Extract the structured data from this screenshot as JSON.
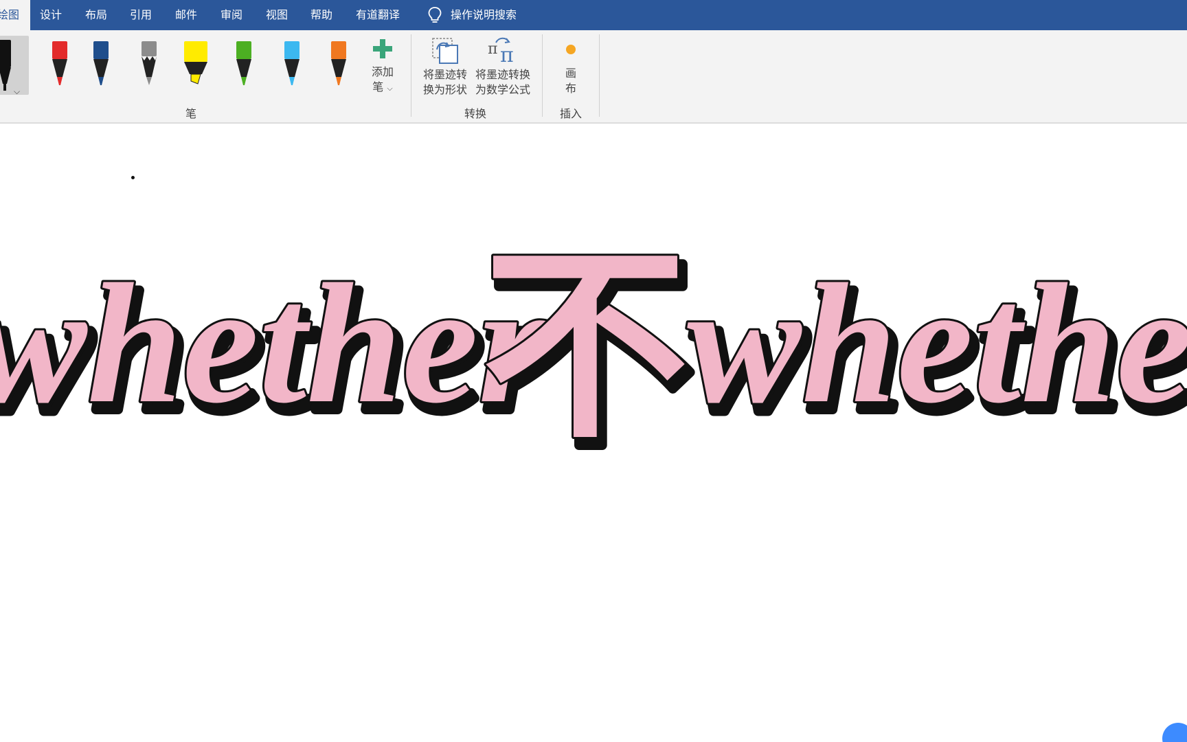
{
  "tabs": [
    {
      "label": "绘图",
      "active": true
    },
    {
      "label": "设计"
    },
    {
      "label": "布局"
    },
    {
      "label": "引用"
    },
    {
      "label": "邮件"
    },
    {
      "label": "审阅"
    },
    {
      "label": "视图"
    },
    {
      "label": "帮助"
    },
    {
      "label": "有道翻译"
    }
  ],
  "search": {
    "label": "操作说明搜索",
    "icon": "lightbulb-icon"
  },
  "ribbon": {
    "pens": [
      {
        "name": "black-pen",
        "color": "#111111",
        "selected": true
      },
      {
        "name": "red-pen",
        "color": "#e32b2b"
      },
      {
        "name": "navy-pen",
        "color": "#1f4e8c"
      },
      {
        "name": "gray-pencil",
        "color": "#8c8c8c"
      },
      {
        "name": "yellow-highlighter",
        "color": "#ffeb00"
      },
      {
        "name": "green-pen",
        "color": "#4caf22"
      },
      {
        "name": "cyan-pen",
        "color": "#3cb8f0"
      },
      {
        "name": "orange-pen",
        "color": "#f07820"
      }
    ],
    "add_pen": {
      "line1": "添加",
      "line2": "笔",
      "icon": "plus-icon",
      "icon_color": "#3aa57a"
    },
    "pen_group_label": "笔",
    "convert_shape": {
      "line1": "将墨迹转",
      "line2": "换为形状"
    },
    "convert_math": {
      "line1": "将墨迹转换",
      "line2": "为数学公式"
    },
    "convert_group_label": "转换",
    "canvas_btn": {
      "line1": "画",
      "line2": "布",
      "icon_color": "#f5a623"
    },
    "insert_group_label": "插入"
  },
  "document": {
    "word_left": "whether",
    "char_middle": "不",
    "word_right": "whether",
    "fill_color": "#f2b6c8",
    "shadow_color": "#111111"
  }
}
